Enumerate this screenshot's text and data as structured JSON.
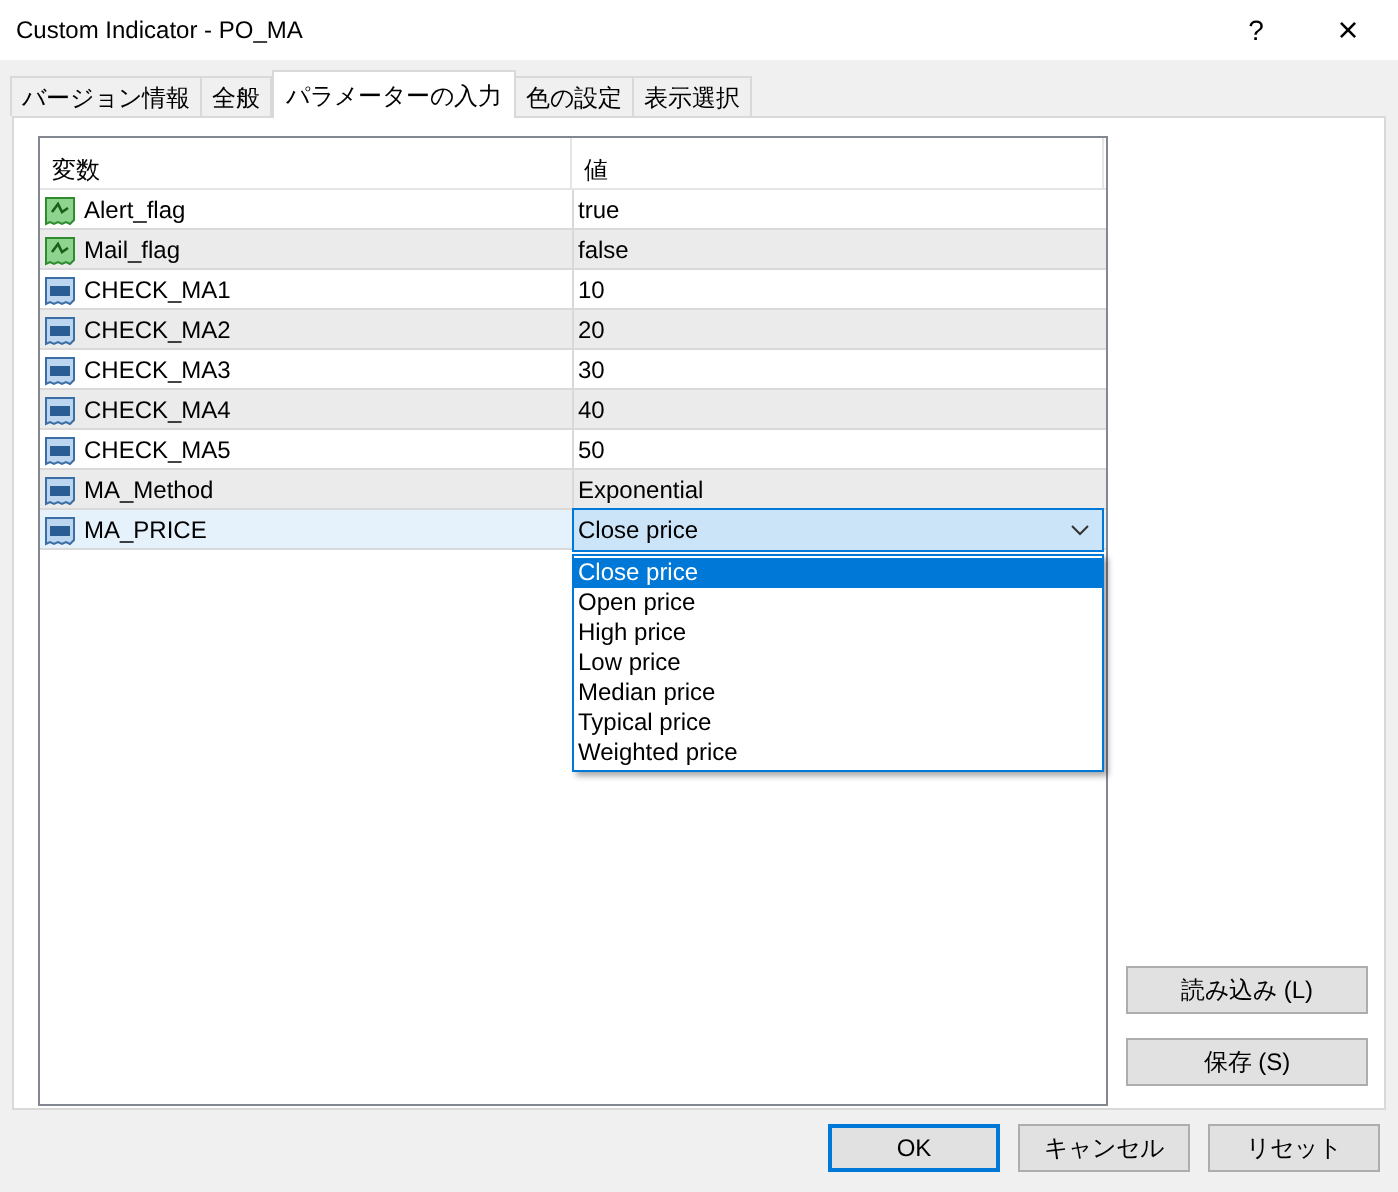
{
  "window": {
    "title": "Custom Indicator - PO_MA",
    "help": "?",
    "close": "×"
  },
  "tabs": [
    {
      "label": "バージョン情報",
      "selected": false
    },
    {
      "label": "全般",
      "selected": false
    },
    {
      "label": "パラメーターの入力",
      "selected": true
    },
    {
      "label": "色の設定",
      "selected": false
    },
    {
      "label": "表示選択",
      "selected": false
    }
  ],
  "table": {
    "columns": [
      "変数",
      "値"
    ],
    "rows": [
      {
        "name": "Alert_flag",
        "value": "true",
        "kind": "bool",
        "selected": false
      },
      {
        "name": "Mail_flag",
        "value": "false",
        "kind": "bool",
        "selected": false
      },
      {
        "name": "CHECK_MA1",
        "value": "10",
        "kind": "int",
        "selected": false
      },
      {
        "name": "CHECK_MA2",
        "value": "20",
        "kind": "int",
        "selected": false
      },
      {
        "name": "CHECK_MA3",
        "value": "30",
        "kind": "int",
        "selected": false
      },
      {
        "name": "CHECK_MA4",
        "value": "40",
        "kind": "int",
        "selected": false
      },
      {
        "name": "CHECK_MA5",
        "value": "50",
        "kind": "int",
        "selected": false
      },
      {
        "name": "MA_Method",
        "value": "Exponential",
        "kind": "int",
        "selected": false
      },
      {
        "name": "MA_PRICE",
        "value": "Close price",
        "kind": "int",
        "selected": true
      }
    ]
  },
  "dropdown": {
    "options": [
      {
        "label": "Close price",
        "selected": true
      },
      {
        "label": "Open price",
        "selected": false
      },
      {
        "label": "High price",
        "selected": false
      },
      {
        "label": "Low price",
        "selected": false
      },
      {
        "label": "Median price",
        "selected": false
      },
      {
        "label": "Typical price",
        "selected": false
      },
      {
        "label": "Weighted price",
        "selected": false
      }
    ]
  },
  "side_buttons": [
    "読み込み (L)",
    "保存 (S)"
  ],
  "buttons": [
    {
      "label": "OK",
      "default": true
    },
    {
      "label": "キャンセル",
      "default": false
    },
    {
      "label": "リセット",
      "default": false
    }
  ]
}
